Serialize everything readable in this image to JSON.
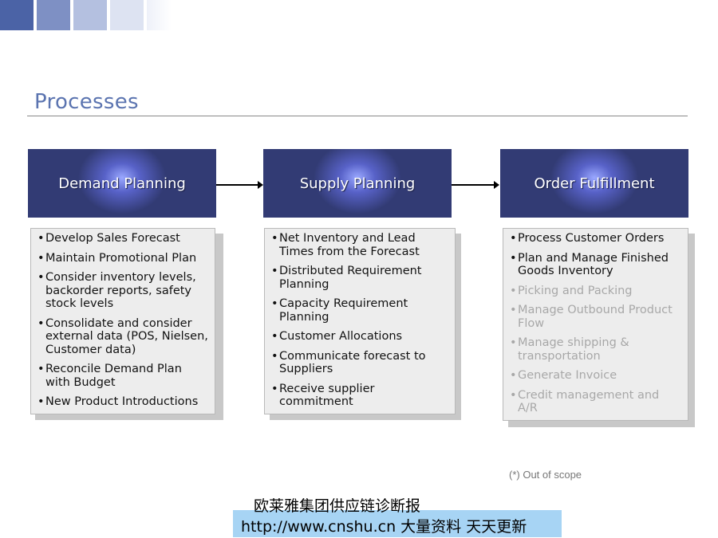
{
  "title": "Processes",
  "stages": [
    {
      "label": "Demand Planning",
      "items": [
        {
          "text": "Develop Sales Forecast",
          "dim": false
        },
        {
          "text": "Maintain Promotional Plan",
          "dim": false
        },
        {
          "text": "Consider inventory levels, backorder reports, safety stock levels",
          "dim": false
        },
        {
          "text": "Consolidate and consider external data (POS, Nielsen, Customer data)",
          "dim": false
        },
        {
          "text": "Reconcile Demand Plan with Budget",
          "dim": false
        },
        {
          "text": "New Product Introductions",
          "dim": false
        }
      ]
    },
    {
      "label": "Supply Planning",
      "items": [
        {
          "text": "Net Inventory and Lead Times from the Forecast",
          "dim": false
        },
        {
          "text": "Distributed Requirement Planning",
          "dim": false
        },
        {
          "text": "Capacity Requirement Planning",
          "dim": false
        },
        {
          "text": "Customer Allocations",
          "dim": false
        },
        {
          "text": "Communicate forecast to Suppliers",
          "dim": false
        },
        {
          "text": "Receive supplier commitment",
          "dim": false
        }
      ]
    },
    {
      "label": "Order Fulfillment",
      "items": [
        {
          "text": "Process Customer Orders",
          "dim": false
        },
        {
          "text": "Plan and Manage Finished Goods Inventory",
          "dim": false
        },
        {
          "text": "Picking and Packing",
          "dim": true
        },
        {
          "text": "Manage Outbound Product Flow",
          "dim": true
        },
        {
          "text": "Manage shipping & transportation",
          "dim": true
        },
        {
          "text": "Generate Invoice",
          "dim": true
        },
        {
          "text": "Credit management and A/R",
          "dim": true
        }
      ]
    }
  ],
  "note": "(*) Out of scope",
  "footer": {
    "line1": "欧莱雅集团供应链诊断报",
    "line2": "http://www.cnshu.cn 大量资料 天天更新"
  },
  "colors": {
    "title": "#5b74b0",
    "header_dark": "#323b74",
    "header_glow": "#9aa8ff",
    "dim_text": "#a8a8a8",
    "footer_band": "#a7d4f4"
  }
}
